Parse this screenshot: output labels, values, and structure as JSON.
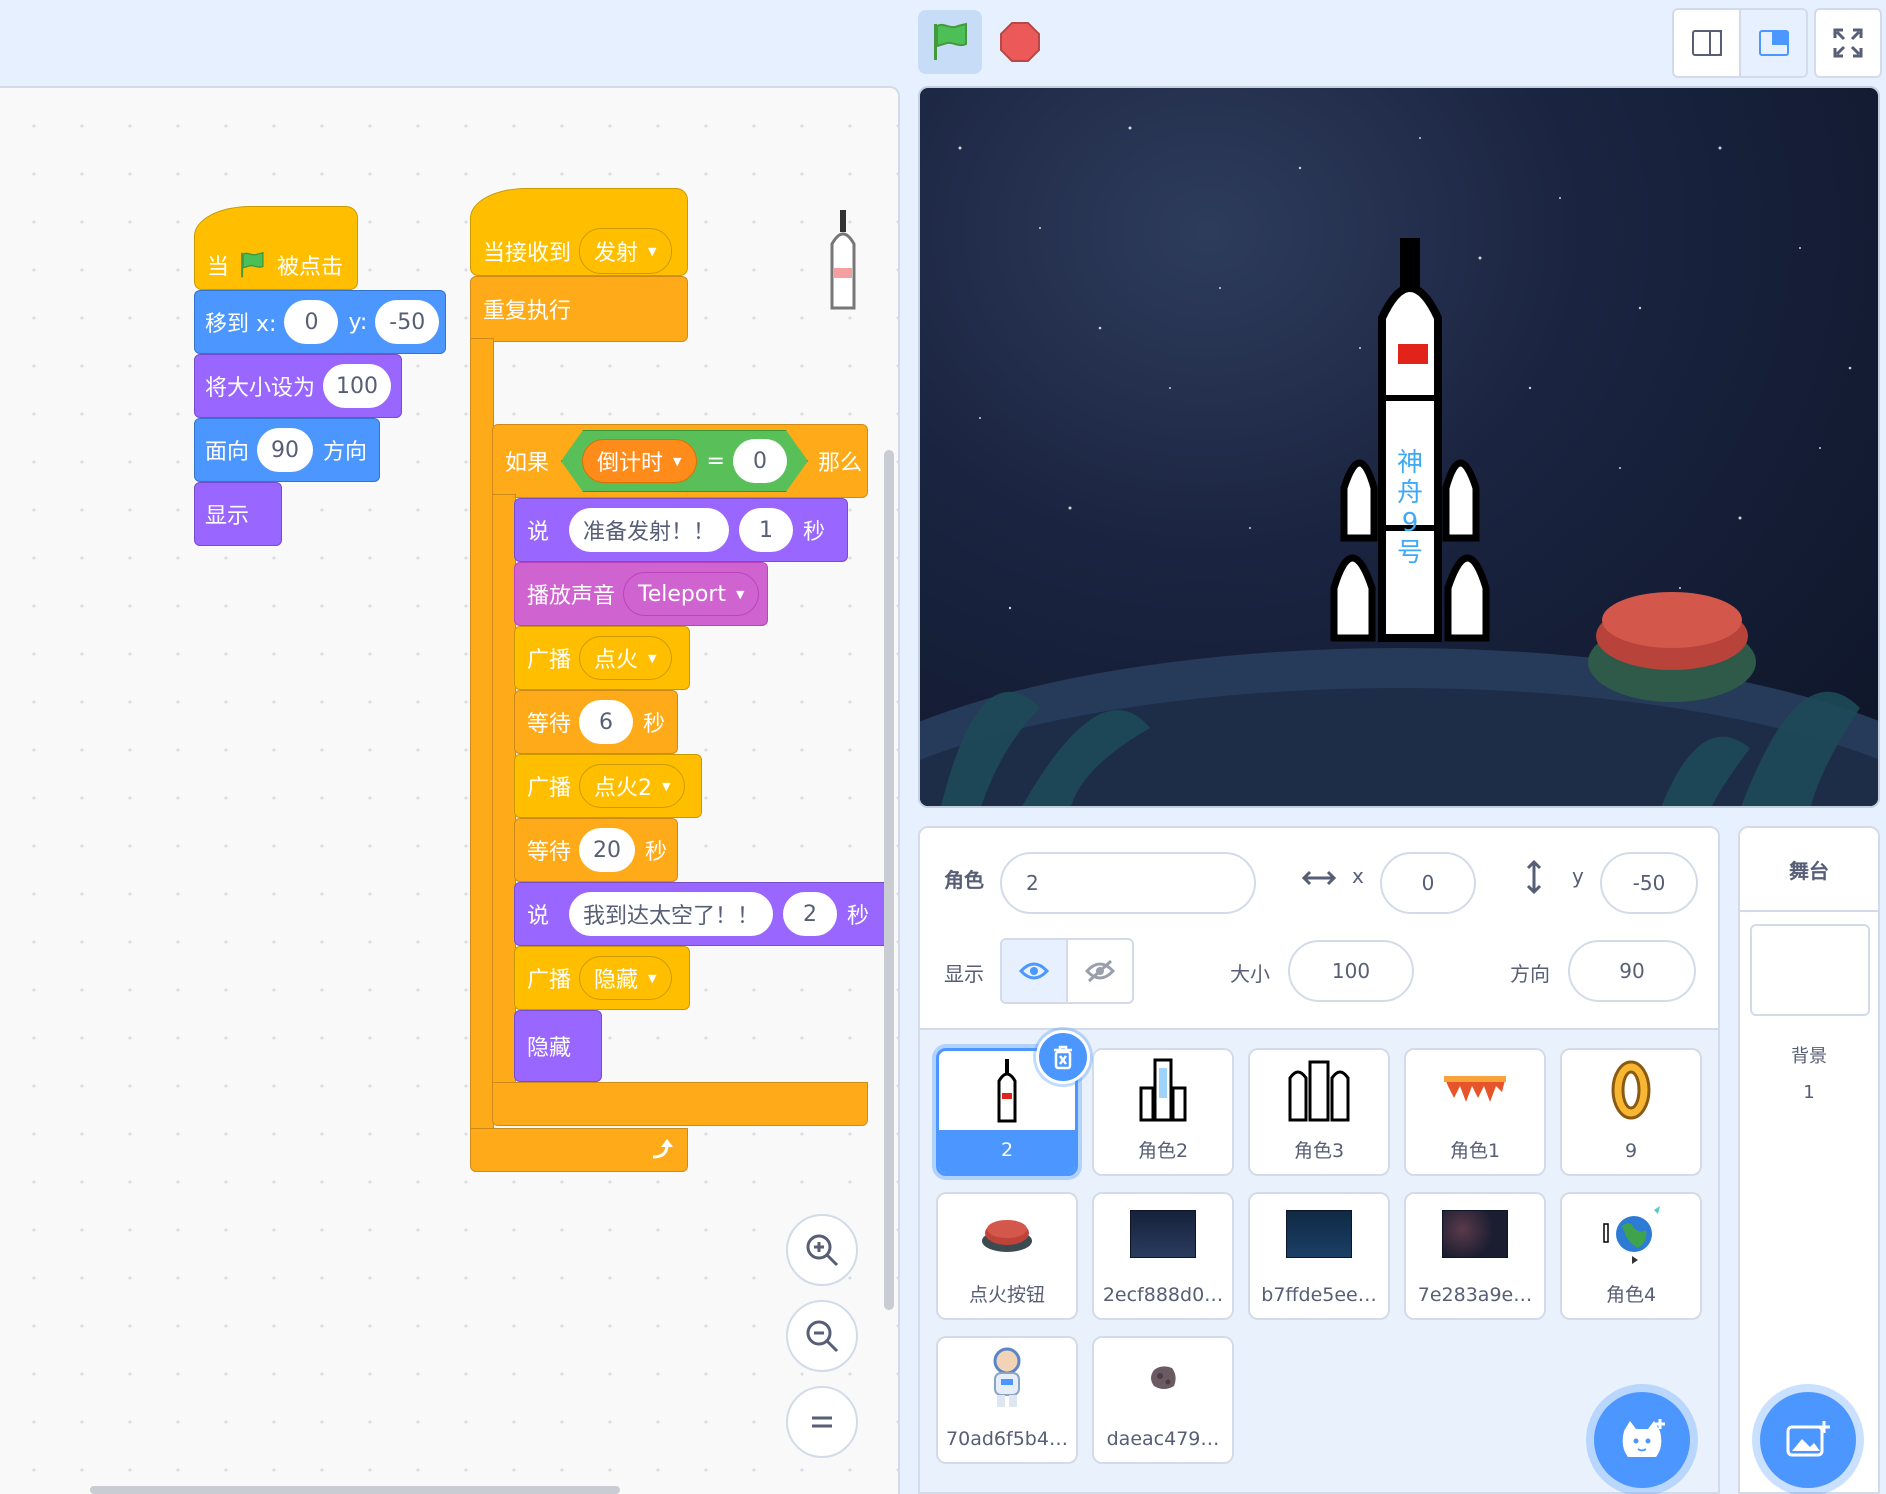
{
  "toolbar": {
    "green_flag_icon": "green-flag-icon",
    "stop_icon": "stop-icon",
    "colors": {
      "flag": "#4cbf56",
      "stop": "#ec5959",
      "accent": "#4c97ff"
    }
  },
  "scripts": {
    "script1": {
      "hat_prefix": "当",
      "hat_suffix": "被点击",
      "goto_label": "移到 x:",
      "goto_x": "0",
      "goto_y_label": "y:",
      "goto_y": "-50",
      "setsize_label": "将大小设为",
      "setsize_value": "100",
      "point_label": "面向",
      "point_value": "90",
      "point_suffix": "方向",
      "show_label": "显示"
    },
    "script2": {
      "hat_label": "当接收到",
      "hat_message": "发射",
      "forever_label": "重复执行",
      "if_label": "如果",
      "if_variable": "倒计时",
      "if_operator": "=",
      "if_value": "0",
      "if_then": "那么",
      "say1_label": "说",
      "say1_text": "准备发射！！",
      "say1_secs": "1",
      "say1_unit": "秒",
      "sound_label": "播放声音",
      "sound_name": "Teleport",
      "bc1_label": "广播",
      "bc1_msg": "点火",
      "wait1_label": "等待",
      "wait1_secs": "6",
      "wait1_unit": "秒",
      "bc2_label": "广播",
      "bc2_msg": "点火2",
      "wait2_label": "等待",
      "wait2_secs": "20",
      "wait2_unit": "秒",
      "say2_label": "说",
      "say2_text": "我到达太空了！！",
      "say2_secs": "2",
      "say2_unit": "秒",
      "bc3_label": "广播",
      "bc3_msg": "隐藏",
      "hide_label": "隐藏"
    }
  },
  "stage": {
    "rocket_text": [
      "神",
      "舟",
      "9",
      "号"
    ]
  },
  "sprite_info": {
    "sprite_label": "角色",
    "sprite_name": "2",
    "x_label": "x",
    "x_value": "0",
    "y_label": "y",
    "y_value": "-50",
    "show_label": "显示",
    "size_label": "大小",
    "size_value": "100",
    "direction_label": "方向",
    "direction_value": "90"
  },
  "sprites": [
    {
      "name": "2",
      "icon": "rocket-icon",
      "selected": true
    },
    {
      "name": "角色2",
      "icon": "rocket-body-icon"
    },
    {
      "name": "角色3",
      "icon": "boosters-icon"
    },
    {
      "name": "角色1",
      "icon": "flames-icon"
    },
    {
      "name": "9",
      "icon": "number-icon"
    },
    {
      "name": "点火按钮",
      "icon": "red-button-icon"
    },
    {
      "name": "2ecf888d0…",
      "icon": "space-image-icon"
    },
    {
      "name": "b7ffde5ee…",
      "icon": "space-image-icon"
    },
    {
      "name": "7e283a9e…",
      "icon": "space-image-icon"
    },
    {
      "name": "角色4",
      "icon": "earth-icon"
    },
    {
      "name": "70ad6f5b4…",
      "icon": "astronaut-icon"
    },
    {
      "name": "daeac479…",
      "icon": "asteroid-icon"
    }
  ],
  "stage_panel": {
    "title": "舞台",
    "backdrop_label": "背景",
    "backdrop_count": "1"
  }
}
